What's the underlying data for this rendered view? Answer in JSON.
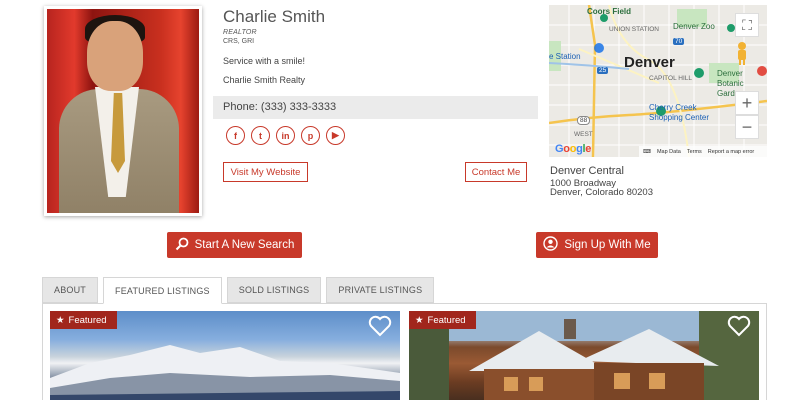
{
  "agent": {
    "name": "Charlie Smith",
    "title": "REALTOR",
    "certifications": "CRS, GRI",
    "tagline": "Service with a smile!",
    "company": "Charlie Smith Realty",
    "phone": "Phone: (333) 333-3333"
  },
  "socials": [
    {
      "icon": "facebook-icon",
      "glyph": "f"
    },
    {
      "icon": "twitter-icon",
      "glyph": "t"
    },
    {
      "icon": "linkedin-icon",
      "glyph": "in"
    },
    {
      "icon": "pinterest-icon",
      "glyph": "p"
    },
    {
      "icon": "youtube-icon",
      "glyph": "▶"
    }
  ],
  "buttons": {
    "visit": "Visit My Website",
    "contact": "Contact Me",
    "search": "Start A New Search",
    "signup": "Sign Up With Me"
  },
  "office": {
    "name": "Denver Central",
    "address_line1": "1000 Broadway",
    "address_line2": "Denver, Colorado 80203"
  },
  "map": {
    "city_label": "Denver",
    "labels": {
      "coors": "Coors Field",
      "union": "UNION STATION",
      "zoo": "Denver Zoo",
      "station": "e Station",
      "capitol": "CAPITOL HILL",
      "botanic": "Denver Botanic Gardens",
      "cherry": "Cherry Creek Shopping Center",
      "west": "WEST",
      "hwy25": "25",
      "hwy88": "88",
      "hwy70": "70"
    },
    "footer": {
      "map_data": "Map Data",
      "terms": "Terms",
      "report": "Report a map error"
    },
    "google": "Google"
  },
  "tabs": [
    {
      "label": "ABOUT",
      "active": false
    },
    {
      "label": "FEATURED LISTINGS",
      "active": true
    },
    {
      "label": "SOLD LISTINGS",
      "active": false
    },
    {
      "label": "PRIVATE LISTINGS",
      "active": false
    }
  ],
  "listings": [
    {
      "badge": "Featured"
    },
    {
      "badge": "Featured"
    }
  ],
  "colors": {
    "accent": "#c8392a",
    "badge": "#a1261c"
  }
}
